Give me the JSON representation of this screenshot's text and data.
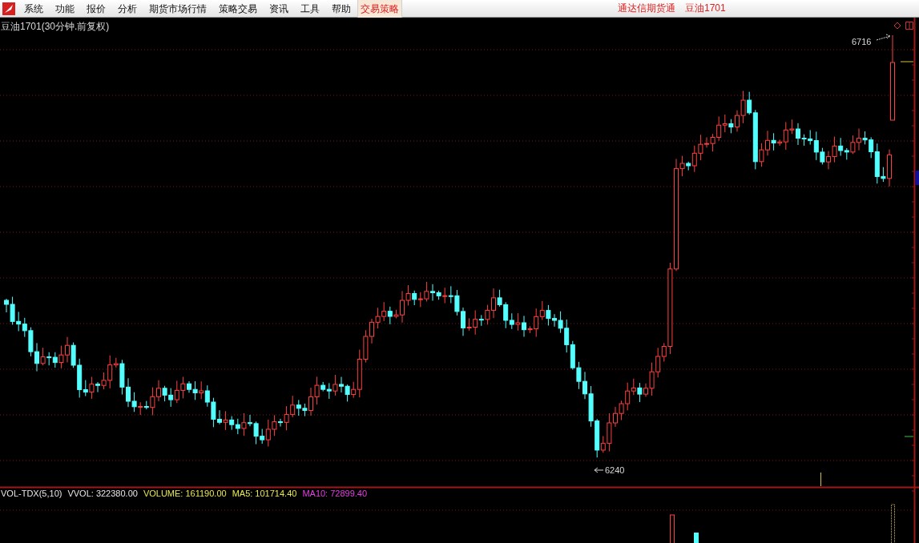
{
  "menu": {
    "items": [
      {
        "label": "系统",
        "selected": false
      },
      {
        "label": "功能",
        "selected": false
      },
      {
        "label": "报价",
        "selected": false
      },
      {
        "label": "分析",
        "selected": false
      },
      {
        "label": "期货市场行情",
        "selected": false
      },
      {
        "label": "策略交易",
        "selected": false
      },
      {
        "label": "资讯",
        "selected": false
      },
      {
        "label": "工具",
        "selected": false
      },
      {
        "label": "帮助",
        "selected": false
      },
      {
        "label": "交易策略",
        "selected": true
      }
    ]
  },
  "app_title": "通达信期货通",
  "instrument": "豆油1701",
  "chart": {
    "title": "豆油1701(30分钟.前复权)",
    "high_label": "6716",
    "low_label": "6240"
  },
  "indicator": {
    "name": "VOL-TDX(5,10)",
    "values": [
      {
        "label": "VVOL: 322380.00",
        "color": "#e6e6e6"
      },
      {
        "label": "VOLUME: 161190.00",
        "color": "#e8e850"
      },
      {
        "label": "MA5: 101714.40",
        "color": "#e8e850"
      },
      {
        "label": "MA10: 72899.40",
        "color": "#e040e0"
      }
    ]
  }
}
